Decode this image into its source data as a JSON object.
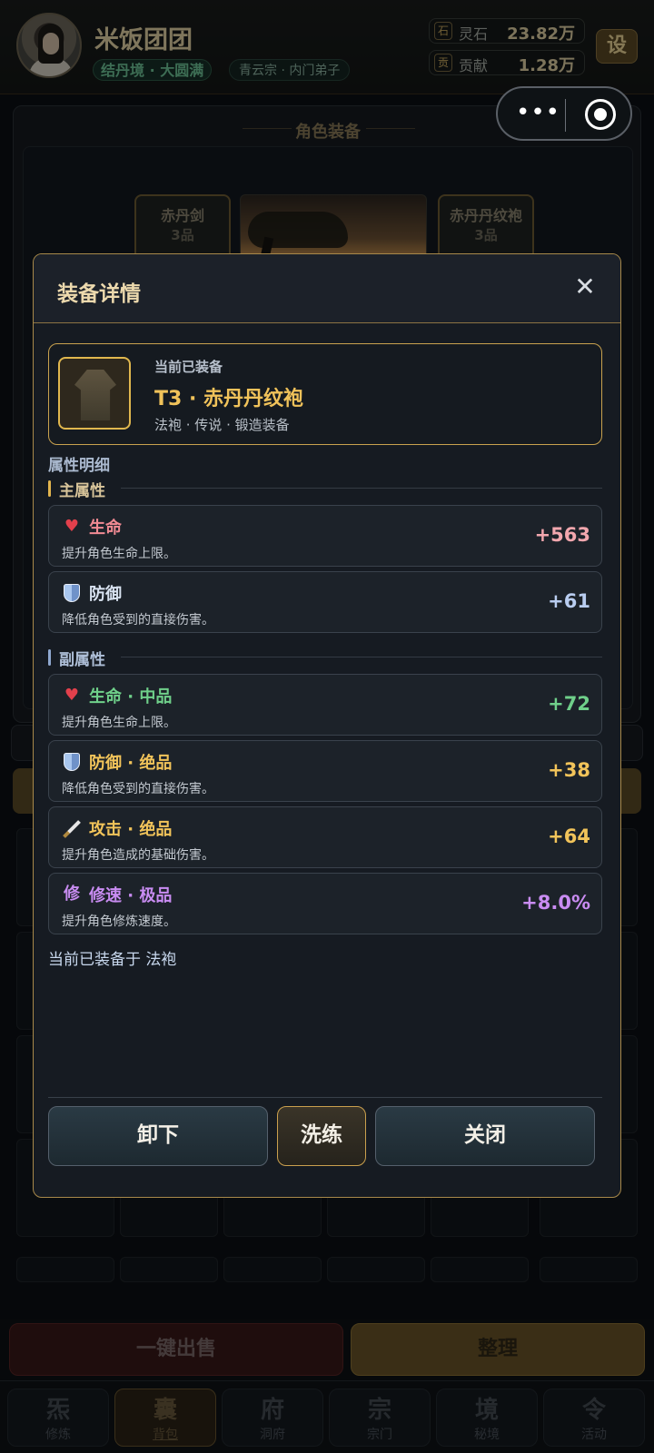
{
  "player": {
    "name": "米饭团团",
    "realm": "结丹境 · 大圆满",
    "sect": "青云宗 · 内门弟子"
  },
  "resources": [
    {
      "icon_text": "石",
      "label": "灵石",
      "value": "23.82万"
    },
    {
      "icon_text": "贡",
      "label": "贡献",
      "value": "1.28万"
    }
  ],
  "settings_label": "设",
  "equipment_panel": {
    "title": "角色装备",
    "slots": [
      {
        "name": "赤丹剑",
        "grade": "3品"
      },
      {
        "name": "赤丹丹纹袍",
        "grade": "3品"
      }
    ]
  },
  "modal": {
    "title": "装备详情",
    "close_icon": "close-icon",
    "current": {
      "tag": "当前已装备",
      "name": "T3 · 赤丹丹纹袍",
      "meta": "法袍 · 传说 · 锻造装备"
    },
    "section_title": "属性明细",
    "main_group": {
      "title": "主属性",
      "items": [
        {
          "icon": "heart-icon",
          "name": "生命",
          "desc": "提升角色生命上限。",
          "value": "+563",
          "name_color": "#f08a93",
          "value_color": "#f2a7ae"
        },
        {
          "icon": "shield-icon",
          "name": "防御",
          "desc": "降低角色受到的直接伤害。",
          "value": "+61",
          "name_color": "#d8e2f0",
          "value_color": "#b9cdf0"
        }
      ]
    },
    "sub_group": {
      "title": "副属性",
      "items": [
        {
          "icon": "heart-icon",
          "name": "生命 · 中品",
          "desc": "提升角色生命上限。",
          "value": "+72",
          "name_color": "#6fd08a",
          "value_color": "#6fd08a"
        },
        {
          "icon": "shield-icon",
          "name": "防御 · 绝品",
          "desc": "降低角色受到的直接伤害。",
          "value": "+38",
          "name_color": "#f2c45a",
          "value_color": "#f2c45a"
        },
        {
          "icon": "sword-icon",
          "name": "攻击 · 绝品",
          "desc": "提升角色造成的基础伤害。",
          "value": "+64",
          "name_color": "#f2c45a",
          "value_color": "#f2c45a"
        },
        {
          "icon": "cultivation-icon",
          "icon_text": "修",
          "name": "修速 · 极品",
          "desc": "提升角色修炼速度。",
          "value": "+8.0%",
          "name_color": "#c98cf2",
          "value_color": "#c98cf2"
        }
      ]
    },
    "equipped_note": "当前已装备于 法袍",
    "buttons": {
      "unequip": "卸下",
      "refine": "洗练",
      "close": "关闭"
    }
  },
  "bottom_actions": {
    "sell": "一键出售",
    "sort": "整理"
  },
  "tabs": [
    {
      "glyph": "炁",
      "label": "修炼"
    },
    {
      "glyph": "囊",
      "label": "背包"
    },
    {
      "glyph": "府",
      "label": "洞府"
    },
    {
      "glyph": "宗",
      "label": "宗门"
    },
    {
      "glyph": "境",
      "label": "秘境"
    },
    {
      "glyph": "令",
      "label": "活动"
    }
  ],
  "active_tab": "背包"
}
